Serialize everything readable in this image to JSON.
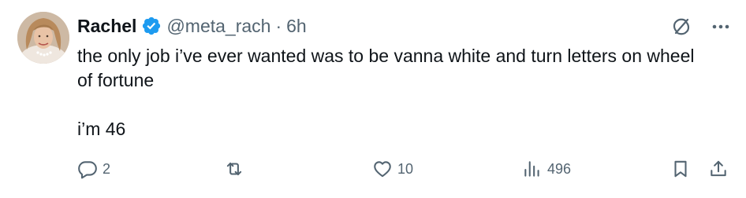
{
  "tweet": {
    "author": {
      "name": "Rachel",
      "handle": "@meta_rach",
      "separator": "·",
      "time": "6h",
      "verified": true,
      "verified_color": "#1d9bf0"
    },
    "text_line1": "the only job i’ve ever wanted was to be vanna white and turn letters on wheel of fortune",
    "text_line2": "i’m 46",
    "metrics": {
      "replies": "2",
      "reposts": "",
      "likes": "10",
      "views": "496"
    },
    "icons": {
      "reply": "reply-icon",
      "repost": "repost-icon",
      "like": "heart-icon",
      "views": "views-icon",
      "bookmark": "bookmark-icon",
      "share": "share-icon",
      "grok": "grok-icon",
      "more": "more-icon"
    },
    "colors": {
      "text": "#0f1419",
      "muted": "#536471",
      "accent": "#1d9bf0"
    }
  }
}
